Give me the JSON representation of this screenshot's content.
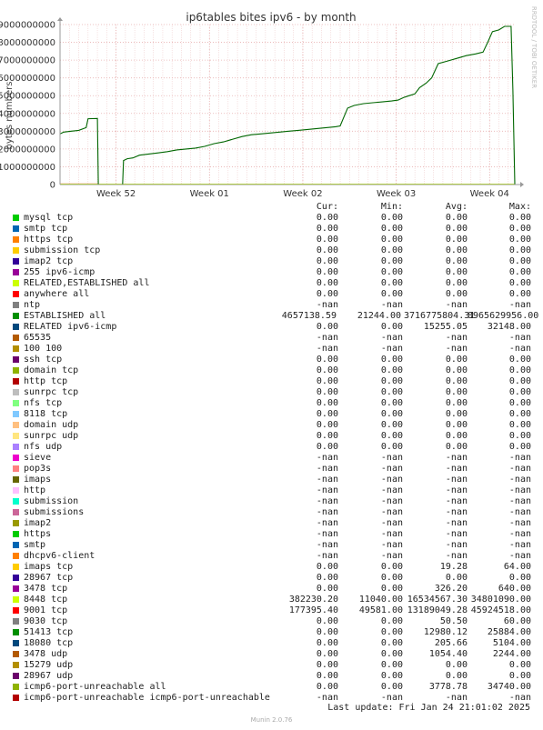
{
  "chart_data": {
    "type": "line",
    "title": "ip6tables bites ipv6 - by month",
    "ylabel": "bytes numbers",
    "watermark": "RRDTOOL / TOBI OETIKER",
    "ylim": [
      0,
      9000000000
    ],
    "y_ticks": [
      0,
      1000000000,
      2000000000,
      3000000000,
      4000000000,
      5000000000,
      6000000000,
      7000000000,
      8000000000,
      9000000000
    ],
    "y_tick_labels": [
      "0",
      "1000000000",
      "2000000000",
      "3000000000",
      "4000000000",
      "5000000000",
      "6000000000",
      "7000000000",
      "8000000000",
      "9000000000"
    ],
    "xlim": [
      0,
      37
    ],
    "x_ticks": [
      {
        "x": 4,
        "label": "Week 52"
      },
      {
        "x": 14,
        "label": "Week 01"
      },
      {
        "x": 24,
        "label": "Week 02"
      },
      {
        "x": 34,
        "label": "Week 03"
      },
      {
        "x": 44,
        "label": "Week 04"
      }
    ],
    "x_axis_ticks_scale": 0.236,
    "grid": true,
    "series": [
      {
        "name": "ESTABLISHED all",
        "color": "#006600",
        "points": [
          [
            0,
            2850000000
          ],
          [
            0.4,
            2950000000
          ],
          [
            1.2,
            3000000000
          ],
          [
            2.0,
            3050000000
          ],
          [
            2.8,
            3200000000
          ],
          [
            3.0,
            3700000000
          ],
          [
            4.0,
            3720000000
          ],
          [
            4.1,
            0
          ],
          [
            6.7,
            0
          ],
          [
            6.8,
            1350000000
          ],
          [
            7.2,
            1450000000
          ],
          [
            7.8,
            1500000000
          ],
          [
            8.5,
            1650000000
          ],
          [
            9.5,
            1720000000
          ],
          [
            10.5,
            1780000000
          ],
          [
            11.5,
            1850000000
          ],
          [
            12.5,
            1950000000
          ],
          [
            13.5,
            2000000000
          ],
          [
            14.5,
            2050000000
          ],
          [
            15.5,
            2150000000
          ],
          [
            16.5,
            2300000000
          ],
          [
            17.5,
            2400000000
          ],
          [
            18.5,
            2550000000
          ],
          [
            19.5,
            2700000000
          ],
          [
            20.5,
            2800000000
          ],
          [
            21.5,
            2850000000
          ],
          [
            22.5,
            2900000000
          ],
          [
            23.5,
            2950000000
          ],
          [
            24.5,
            3000000000
          ],
          [
            25.5,
            3050000000
          ],
          [
            26.5,
            3100000000
          ],
          [
            27.5,
            3150000000
          ],
          [
            28.5,
            3200000000
          ],
          [
            29.5,
            3250000000
          ],
          [
            30.0,
            3300000000
          ],
          [
            30.4,
            3800000000
          ],
          [
            30.8,
            4300000000
          ],
          [
            31.5,
            4450000000
          ],
          [
            32.5,
            4550000000
          ],
          [
            33.5,
            4600000000
          ],
          [
            34.5,
            4650000000
          ],
          [
            35.5,
            4700000000
          ],
          [
            36.2,
            4750000000
          ],
          [
            36.8,
            4900000000
          ],
          [
            37.4,
            5000000000
          ],
          [
            38.0,
            5100000000
          ],
          [
            38.5,
            5450000000
          ],
          [
            39.2,
            5700000000
          ],
          [
            39.8,
            6000000000
          ],
          [
            40.5,
            6800000000
          ],
          [
            41.5,
            6950000000
          ],
          [
            42.5,
            7100000000
          ],
          [
            43.5,
            7250000000
          ],
          [
            44.5,
            7350000000
          ],
          [
            45.3,
            7450000000
          ],
          [
            45.8,
            8000000000
          ],
          [
            46.3,
            8600000000
          ],
          [
            47.0,
            8700000000
          ],
          [
            47.6,
            8900000000
          ],
          [
            48.3,
            8900000000
          ],
          [
            48.5,
            5300000000
          ],
          [
            48.7,
            0
          ]
        ]
      },
      {
        "name": "8448 tcp",
        "color": "#CCFF00",
        "points": [
          [
            0,
            20000000
          ],
          [
            48.7,
            20000000
          ]
        ]
      },
      {
        "name": "9001 tcp",
        "color": "#FF0000",
        "points": [
          [
            0,
            30000000
          ],
          [
            4.0,
            30000000
          ],
          [
            4.1,
            0
          ],
          [
            48.7,
            0
          ]
        ]
      }
    ],
    "legend_headers": [
      "Cur:",
      "Min:",
      "Avg:",
      "Max:"
    ],
    "legend": [
      {
        "name": "mysql tcp",
        "color": "#00CC00",
        "cur": "0.00",
        "min": "0.00",
        "avg": "0.00",
        "max": "0.00"
      },
      {
        "name": "smtp tcp",
        "color": "#0066B3",
        "cur": "0.00",
        "min": "0.00",
        "avg": "0.00",
        "max": "0.00"
      },
      {
        "name": "https tcp",
        "color": "#FF8000",
        "cur": "0.00",
        "min": "0.00",
        "avg": "0.00",
        "max": "0.00"
      },
      {
        "name": "submission tcp",
        "color": "#FFCC00",
        "cur": "0.00",
        "min": "0.00",
        "avg": "0.00",
        "max": "0.00"
      },
      {
        "name": "imap2 tcp",
        "color": "#330099",
        "cur": "0.00",
        "min": "0.00",
        "avg": "0.00",
        "max": "0.00"
      },
      {
        "name": "255 ipv6-icmp",
        "color": "#990099",
        "cur": "0.00",
        "min": "0.00",
        "avg": "0.00",
        "max": "0.00"
      },
      {
        "name": "RELATED,ESTABLISHED all",
        "color": "#CCFF00",
        "cur": "0.00",
        "min": "0.00",
        "avg": "0.00",
        "max": "0.00"
      },
      {
        "name": "anywhere all",
        "color": "#FF0000",
        "cur": "0.00",
        "min": "0.00",
        "avg": "0.00",
        "max": "0.00"
      },
      {
        "name": "ntp",
        "color": "#808080",
        "cur": "-nan",
        "min": "-nan",
        "avg": "-nan",
        "max": "-nan"
      },
      {
        "name": "ESTABLISHED all",
        "color": "#008F00",
        "cur": "4657138.59",
        "min": "21244.00",
        "avg": "3716775804.31",
        "max": "8965629956.00",
        "tight": true
      },
      {
        "name": "RELATED ipv6-icmp",
        "color": "#00487D",
        "cur": "0.00",
        "min": "0.00",
        "avg": "15255.05",
        "max": "32148.00"
      },
      {
        "name": "65535",
        "color": "#B35A00",
        "cur": "-nan",
        "min": "-nan",
        "avg": "-nan",
        "max": "-nan"
      },
      {
        "name": "100 100",
        "color": "#B38F00",
        "cur": "-nan",
        "min": "-nan",
        "avg": "-nan",
        "max": "-nan"
      },
      {
        "name": "ssh tcp",
        "color": "#6B006B",
        "cur": "0.00",
        "min": "0.00",
        "avg": "0.00",
        "max": "0.00"
      },
      {
        "name": "domain tcp",
        "color": "#8FB300",
        "cur": "0.00",
        "min": "0.00",
        "avg": "0.00",
        "max": "0.00"
      },
      {
        "name": "http tcp",
        "color": "#B30000",
        "cur": "0.00",
        "min": "0.00",
        "avg": "0.00",
        "max": "0.00"
      },
      {
        "name": "sunrpc tcp",
        "color": "#BEBEBE",
        "cur": "0.00",
        "min": "0.00",
        "avg": "0.00",
        "max": "0.00"
      },
      {
        "name": "nfs tcp",
        "color": "#80FF80",
        "cur": "0.00",
        "min": "0.00",
        "avg": "0.00",
        "max": "0.00"
      },
      {
        "name": "8118 tcp",
        "color": "#80C9FF",
        "cur": "0.00",
        "min": "0.00",
        "avg": "0.00",
        "max": "0.00"
      },
      {
        "name": "domain udp",
        "color": "#FFC080",
        "cur": "0.00",
        "min": "0.00",
        "avg": "0.00",
        "max": "0.00"
      },
      {
        "name": "sunrpc udp",
        "color": "#FFE680",
        "cur": "0.00",
        "min": "0.00",
        "avg": "0.00",
        "max": "0.00"
      },
      {
        "name": "nfs udp",
        "color": "#AA80FF",
        "cur": "0.00",
        "min": "0.00",
        "avg": "0.00",
        "max": "0.00"
      },
      {
        "name": "sieve",
        "color": "#EE00CC",
        "cur": "-nan",
        "min": "-nan",
        "avg": "-nan",
        "max": "-nan"
      },
      {
        "name": "pop3s",
        "color": "#FF8080",
        "cur": "-nan",
        "min": "-nan",
        "avg": "-nan",
        "max": "-nan"
      },
      {
        "name": "imaps",
        "color": "#666600",
        "cur": "-nan",
        "min": "-nan",
        "avg": "-nan",
        "max": "-nan"
      },
      {
        "name": "http",
        "color": "#FFBFFF",
        "cur": "-nan",
        "min": "-nan",
        "avg": "-nan",
        "max": "-nan"
      },
      {
        "name": "submission",
        "color": "#00FFCC",
        "cur": "-nan",
        "min": "-nan",
        "avg": "-nan",
        "max": "-nan"
      },
      {
        "name": "submissions",
        "color": "#CC6699",
        "cur": "-nan",
        "min": "-nan",
        "avg": "-nan",
        "max": "-nan"
      },
      {
        "name": "imap2",
        "color": "#999900",
        "cur": "-nan",
        "min": "-nan",
        "avg": "-nan",
        "max": "-nan"
      },
      {
        "name": "https",
        "color": "#00CC00",
        "cur": "-nan",
        "min": "-nan",
        "avg": "-nan",
        "max": "-nan"
      },
      {
        "name": "smtp",
        "color": "#0066B3",
        "cur": "-nan",
        "min": "-nan",
        "avg": "-nan",
        "max": "-nan"
      },
      {
        "name": "dhcpv6-client",
        "color": "#FF8000",
        "cur": "-nan",
        "min": "-nan",
        "avg": "-nan",
        "max": "-nan"
      },
      {
        "name": "imaps tcp",
        "color": "#FFCC00",
        "cur": "0.00",
        "min": "0.00",
        "avg": "19.28",
        "max": "64.00"
      },
      {
        "name": "28967 tcp",
        "color": "#330099",
        "cur": "0.00",
        "min": "0.00",
        "avg": "0.00",
        "max": "0.00"
      },
      {
        "name": "3478 tcp",
        "color": "#990099",
        "cur": "0.00",
        "min": "0.00",
        "avg": "326.20",
        "max": "640.00"
      },
      {
        "name": "8448 tcp",
        "color": "#CCFF00",
        "cur": "382230.20",
        "min": "11040.00",
        "avg": "16534567.30",
        "max": "34801090.00"
      },
      {
        "name": "9001 tcp",
        "color": "#FF0000",
        "cur": "177395.40",
        "min": "49581.00",
        "avg": "13189049.28",
        "max": "45924518.00"
      },
      {
        "name": "9030 tcp",
        "color": "#808080",
        "cur": "0.00",
        "min": "0.00",
        "avg": "50.50",
        "max": "60.00"
      },
      {
        "name": "51413 tcp",
        "color": "#008F00",
        "cur": "0.00",
        "min": "0.00",
        "avg": "12980.12",
        "max": "25884.00"
      },
      {
        "name": "18080 tcp",
        "color": "#00487D",
        "cur": "0.00",
        "min": "0.00",
        "avg": "205.66",
        "max": "5104.00"
      },
      {
        "name": "3478 udp",
        "color": "#B35A00",
        "cur": "0.00",
        "min": "0.00",
        "avg": "1054.40",
        "max": "2244.00"
      },
      {
        "name": "15279 udp",
        "color": "#B38F00",
        "cur": "0.00",
        "min": "0.00",
        "avg": "0.00",
        "max": "0.00"
      },
      {
        "name": "28967 udp",
        "color": "#6B006B",
        "cur": "0.00",
        "min": "0.00",
        "avg": "0.00",
        "max": "0.00"
      },
      {
        "name": "icmp6-port-unreachable all",
        "color": "#8FB300",
        "cur": "0.00",
        "min": "0.00",
        "avg": "3778.78",
        "max": "34740.00"
      },
      {
        "name": "icmp6-port-unreachable icmp6-port-unreachable",
        "color": "#B30000",
        "cur": "-nan",
        "min": "-nan",
        "avg": "-nan",
        "max": "-nan"
      }
    ]
  },
  "footer": {
    "last_update": "Last update: Fri Jan 24 21:01:02 2025",
    "munin_version": "Munin 2.0.76"
  }
}
